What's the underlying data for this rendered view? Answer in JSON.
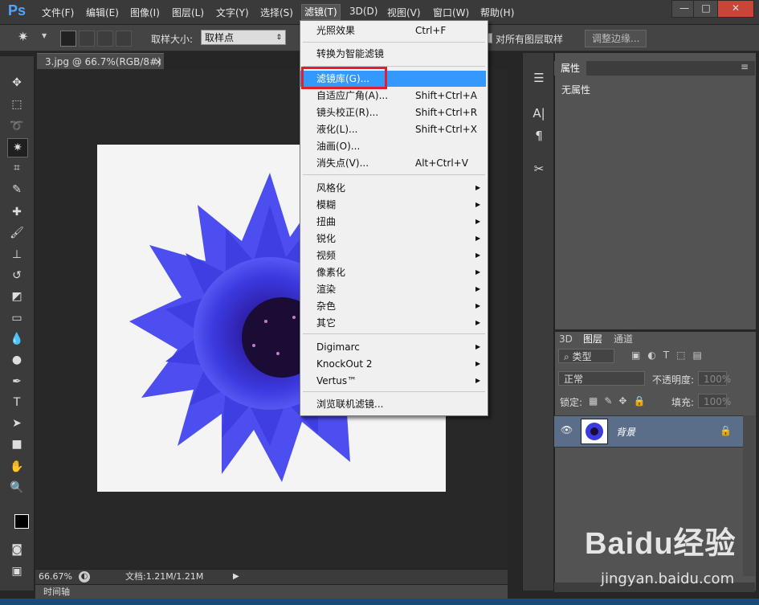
{
  "app": {
    "logo": "Ps"
  },
  "menubar": {
    "items": [
      "文件(F)",
      "编辑(E)",
      "图像(I)",
      "图层(L)",
      "文字(Y)",
      "选择(S)",
      "滤镜(T)",
      "3D(D)",
      "视图(V)",
      "窗口(W)",
      "帮助(H)"
    ],
    "active_index": 6,
    "window_controls": [
      "—",
      "□",
      "✕"
    ]
  },
  "options": {
    "sample_size_label": "取样大小:",
    "sample_size_value": "取样点",
    "sample_all_layers_label": "对所有图层取样",
    "refine_edge_label": "调整边缘..."
  },
  "document": {
    "tab_title": "3.jpg @ 66.7%(RGB/8#)",
    "tab_close": "×",
    "zoom": "66.67%",
    "doc_info": "文档:1.21M/1.21M",
    "timeline_label": "时间轴"
  },
  "filter_menu": {
    "items": [
      {
        "label": "光照效果",
        "shortcut": "Ctrl+F"
      },
      {
        "label": "转换为智能滤镜",
        "shortcut": ""
      },
      {
        "label": "滤镜库(G)...",
        "shortcut": ""
      },
      {
        "label": "自适应广角(A)...",
        "shortcut": "Shift+Ctrl+A"
      },
      {
        "label": "镜头校正(R)...",
        "shortcut": "Shift+Ctrl+R"
      },
      {
        "label": "液化(L)...",
        "shortcut": "Shift+Ctrl+X"
      },
      {
        "label": "油画(O)...",
        "shortcut": ""
      },
      {
        "label": "消失点(V)...",
        "shortcut": "Alt+Ctrl+V"
      },
      {
        "label": "风格化"
      },
      {
        "label": "模糊"
      },
      {
        "label": "扭曲"
      },
      {
        "label": "锐化"
      },
      {
        "label": "视频"
      },
      {
        "label": "像素化"
      },
      {
        "label": "渲染"
      },
      {
        "label": "杂色"
      },
      {
        "label": "其它"
      },
      {
        "label": "Digimarc"
      },
      {
        "label": "KnockOut 2"
      },
      {
        "label": "Vertus™"
      },
      {
        "label": "浏览联机滤镜..."
      }
    ],
    "highlighted_index": 2,
    "highlight_color": "#3399ff",
    "annotation_color": "#e0202b"
  },
  "properties_panel": {
    "tab": "属性",
    "content": "无属性"
  },
  "layers_panel": {
    "tabs": [
      "3D",
      "图层",
      "通道"
    ],
    "active_tab": 1,
    "filter_kind": "类型",
    "blend_mode": "正常",
    "opacity_label": "不透明度:",
    "opacity_value": "100%",
    "lock_label": "锁定:",
    "fill_label": "填充:",
    "fill_value": "100%",
    "layer_name": "背景"
  },
  "watermark": {
    "brand": "Baidu经验",
    "url": "jingyan.baidu.com"
  }
}
